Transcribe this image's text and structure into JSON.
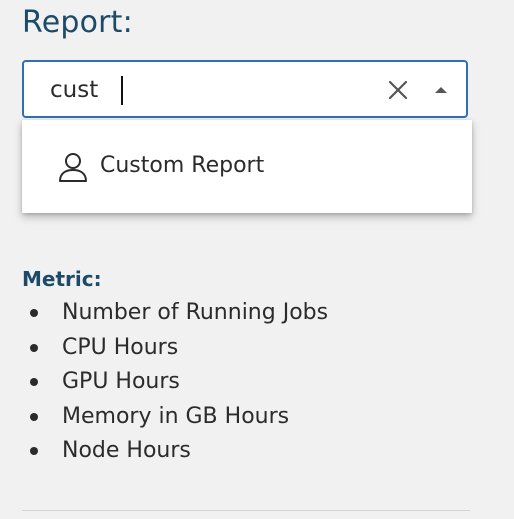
{
  "report": {
    "heading": "Report:",
    "search_value": "cust",
    "clear_icon": "close-icon",
    "toggle_icon": "triangle-up-icon"
  },
  "dropdown": {
    "options": [
      {
        "label": "Custom Report",
        "icon": "user-icon"
      }
    ]
  },
  "metric": {
    "heading": "Metric:",
    "items": [
      "Number of Running Jobs",
      "CPU Hours",
      "GPU Hours",
      "Memory in GB Hours",
      "Node Hours"
    ]
  }
}
